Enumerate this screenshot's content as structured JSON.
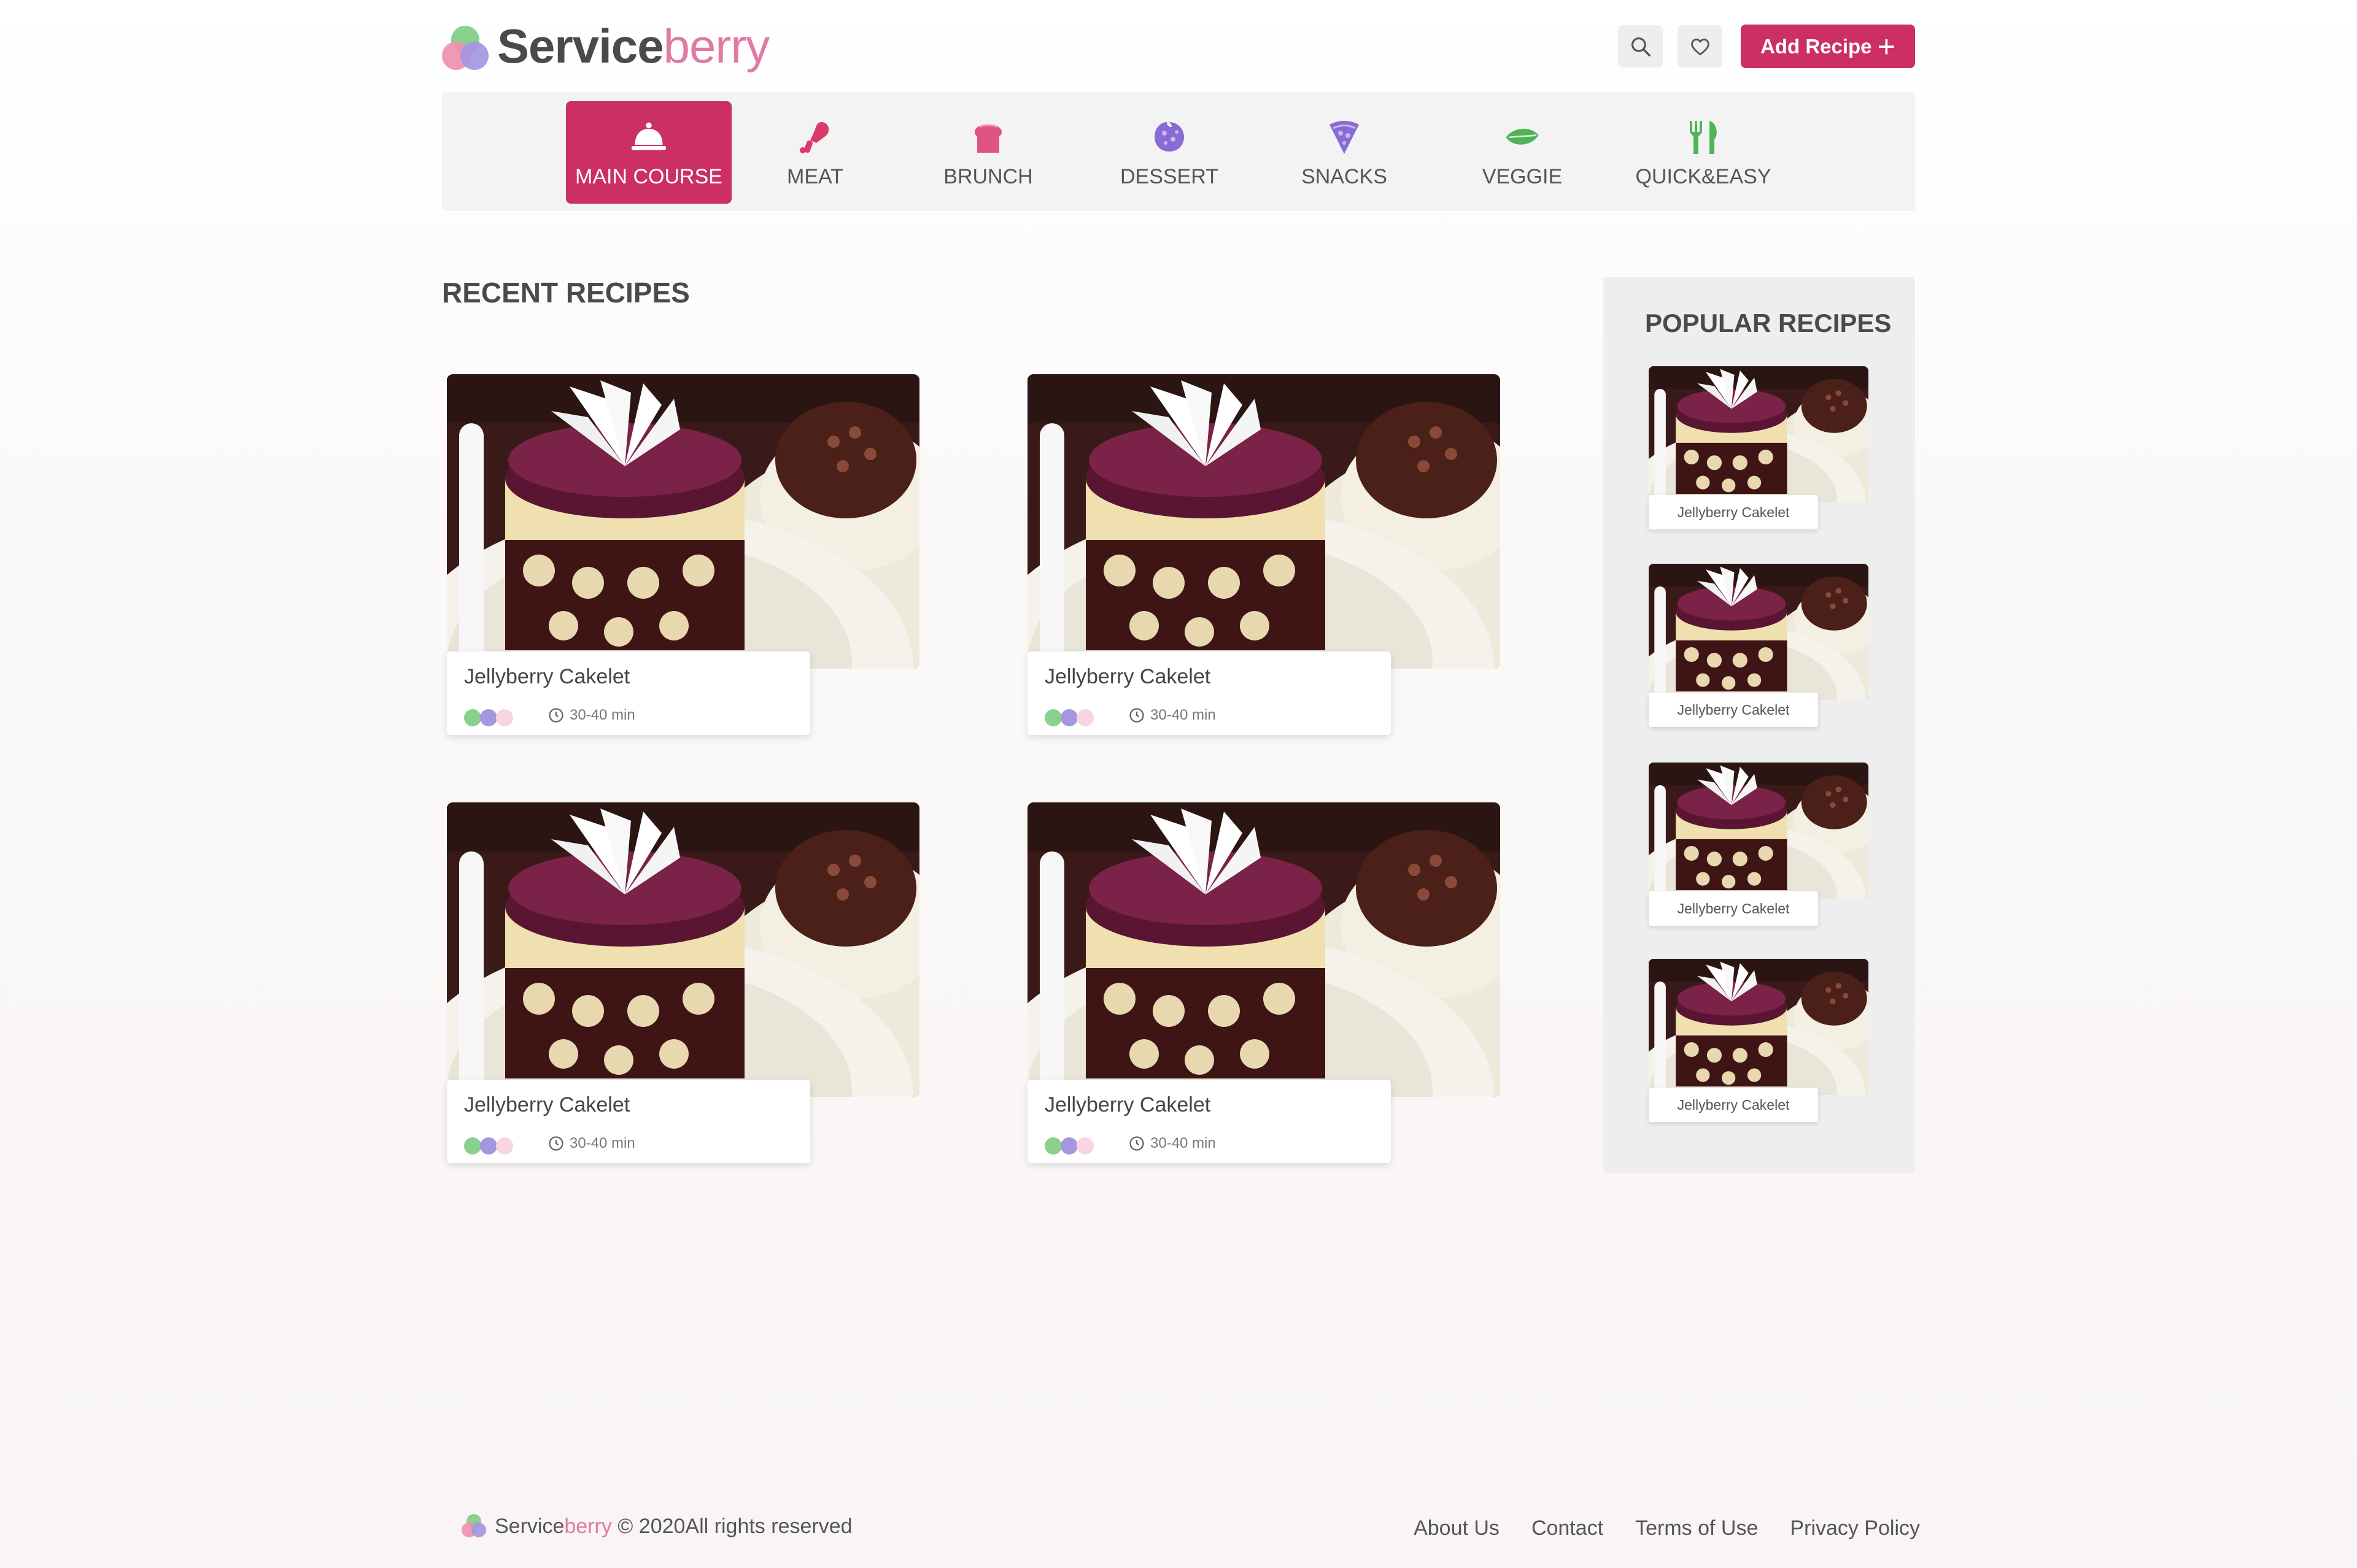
{
  "header": {
    "logo_main": "Service",
    "logo_accent": "berry",
    "search_icon": "search-icon",
    "favorites_icon": "heart-icon",
    "add_recipe_label": "Add Recipe",
    "add_icon": "plus-icon"
  },
  "categories": [
    {
      "label": "MAIN COURSE",
      "icon": "cloche-icon",
      "active": true
    },
    {
      "label": "MEAT",
      "icon": "drumstick-icon",
      "active": false
    },
    {
      "label": "BRUNCH",
      "icon": "bread-icon",
      "active": false
    },
    {
      "label": "DESSERT",
      "icon": "cookie-icon",
      "active": false
    },
    {
      "label": "SNACKS",
      "icon": "pizza-icon",
      "active": false
    },
    {
      "label": "VEGGIE",
      "icon": "leaf-icon",
      "active": false
    },
    {
      "label": "QUICK&EASY",
      "icon": "fork-knife-icon",
      "active": false
    }
  ],
  "recent": {
    "heading": "RECENT RECIPES",
    "items": [
      {
        "title": "Jellyberry Cakelet",
        "time": "30-40 min"
      },
      {
        "title": "Jellyberry Cakelet",
        "time": "30-40 min"
      },
      {
        "title": "Jellyberry Cakelet",
        "time": "30-40 min"
      },
      {
        "title": "Jellyberry Cakelet",
        "time": "30-40 min"
      }
    ]
  },
  "popular": {
    "heading": "POPULAR RECIPES",
    "items": [
      {
        "title": "Jellyberry Cakelet"
      },
      {
        "title": "Jellyberry Cakelet"
      },
      {
        "title": "Jellyberry Cakelet"
      },
      {
        "title": "Jellyberry Cakelet"
      }
    ]
  },
  "footer": {
    "brand_main": "Service",
    "brand_accent": "berry",
    "copyright": "© 2020All rights reserved",
    "links": [
      "About Us",
      "Contact",
      "Terms of Use",
      "Privacy Policy"
    ]
  },
  "colors": {
    "brand": "#cc2f62",
    "logo_pink": "#e07aa4",
    "difficulty": [
      "#8ad08f",
      "#a596e0",
      "#f7d5e3"
    ]
  }
}
